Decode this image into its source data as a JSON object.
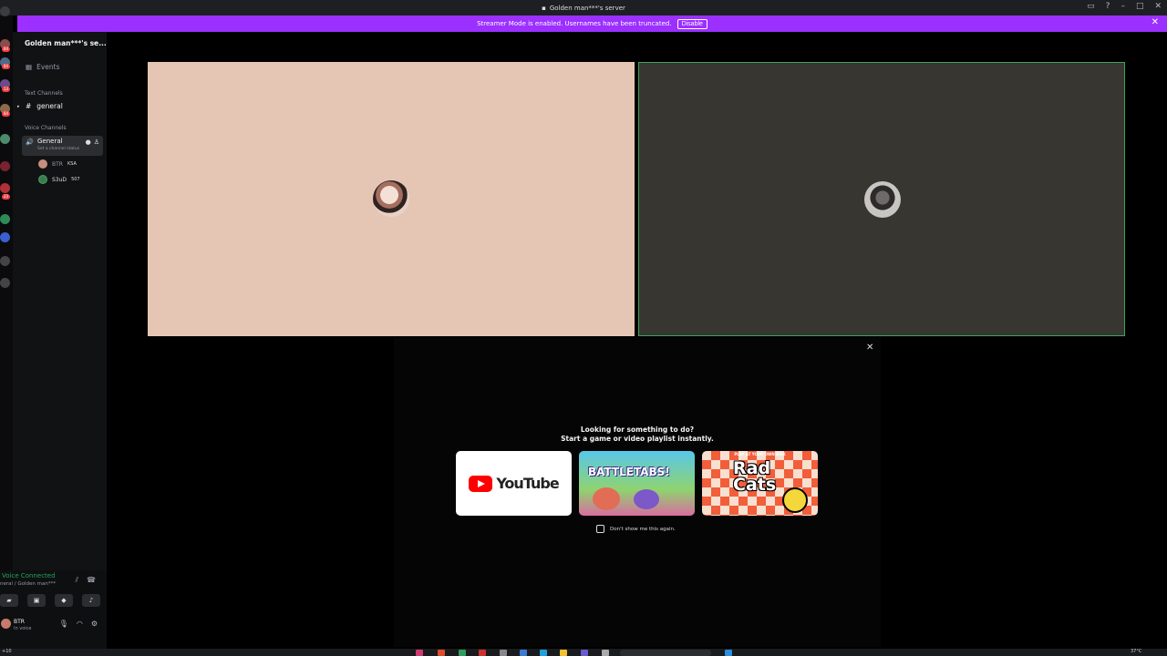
{
  "window": {
    "title": "Golden man***'s server"
  },
  "streamer_banner": {
    "text": "Streamer Mode is enabled. Usernames have been truncated.",
    "disable_label": "Disable",
    "close_icon": "close-icon"
  },
  "guild_rail": {
    "badges": [
      "84",
      "84",
      "13",
      "84",
      "23"
    ]
  },
  "sidebar": {
    "server_name": "Golden man***'s se...",
    "events_label": "Events",
    "text_category": "Text Channels",
    "text_channels": [
      {
        "name": "general"
      }
    ],
    "voice_category": "Voice Channels",
    "voice_channel": {
      "name": "General",
      "status": "Set a channel status"
    },
    "voice_users": [
      {
        "name": "BTR",
        "tag": "KSA"
      },
      {
        "name": "S3uD",
        "tag": "507"
      }
    ]
  },
  "panel": {
    "voice_connected": "Voice Connected",
    "voice_location": "neral / Golden man***",
    "user": {
      "name": "BTR",
      "status": "In voice"
    }
  },
  "activity": {
    "title_line1": "Looking for something to do?",
    "title_line2": "Start a game or video playlist instantly.",
    "cards": [
      {
        "name": "YouTube"
      },
      {
        "name": "BATTLETABS!"
      },
      {
        "name": "Rad Cats",
        "top_text": "PLAY AT YOUR OWN RISK"
      }
    ],
    "dont_show": "Don't show me this again."
  },
  "taskbar": {
    "left_text": "+10",
    "right_text": "37°C"
  },
  "colors": {
    "streamer_purple": "#9b30ff",
    "speaking_green": "#3ba55c",
    "voice_green": "#23a55a",
    "left_tile": "#e5c6b5",
    "right_tile": "#373630"
  }
}
